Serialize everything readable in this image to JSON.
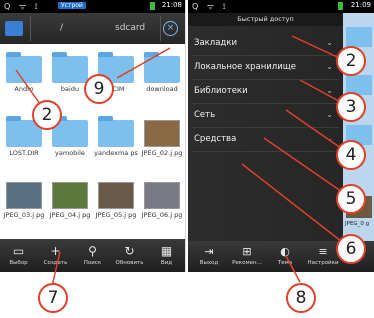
{
  "left_phone": {
    "status": {
      "icons_left": "Q ᯤ ⟟",
      "app_badge": "Устрой",
      "time": "21:08"
    },
    "pathbar": {
      "root": "/",
      "current": "sdcard"
    },
    "tiles": [
      {
        "kind": "folder",
        "label": "Andro"
      },
      {
        "kind": "folder",
        "label": "baidu"
      },
      {
        "kind": "folder",
        "label": "DCIM"
      },
      {
        "kind": "folder",
        "label": "download"
      },
      {
        "kind": "folder",
        "label": "LOST.DIR"
      },
      {
        "kind": "folder",
        "label": "yamobile"
      },
      {
        "kind": "folder",
        "label": "yandexma ps"
      },
      {
        "kind": "photo",
        "label": "JPEG_02.j pg",
        "color": "#8a6a44"
      },
      {
        "kind": "photo",
        "label": "JPEG_03.j pg",
        "color": "#596f84"
      },
      {
        "kind": "photo",
        "label": "JPEG_04.j pg",
        "color": "#5c7a3c"
      },
      {
        "kind": "photo",
        "label": "JPEG_05.j pg",
        "color": "#6a5a4a"
      },
      {
        "kind": "photo",
        "label": "JPEG_06.j pg",
        "color": "#7a7a86"
      }
    ],
    "toolbar": [
      {
        "icon": "select-icon",
        "glyph": "▭",
        "label": "Выбор"
      },
      {
        "icon": "plus-icon",
        "glyph": "+",
        "label": "Создать"
      },
      {
        "icon": "search-icon",
        "glyph": "⚲",
        "label": "Поиск"
      },
      {
        "icon": "refresh-icon",
        "glyph": "↻",
        "label": "Обновить"
      },
      {
        "icon": "grid-icon",
        "glyph": "▦",
        "label": "Вид"
      }
    ]
  },
  "right_phone": {
    "status": {
      "icons_left": "Q ᯤ ⟟",
      "time": "21:09"
    },
    "title": "Быстрый доступ",
    "drawer": [
      {
        "label": "Закладки"
      },
      {
        "label": "Локальное хранилище"
      },
      {
        "label": "Библиотеки"
      },
      {
        "label": "Сеть"
      },
      {
        "label": "Средства"
      }
    ],
    "peek_label": "JPEG_0 g",
    "toolbar": [
      {
        "icon": "exit-icon",
        "glyph": "⇥",
        "label": "Выход"
      },
      {
        "icon": "gift-icon",
        "glyph": "⊞",
        "label": "Рекомен..."
      },
      {
        "icon": "theme-icon",
        "glyph": "◐",
        "label": "Тема"
      },
      {
        "icon": "settings-icon",
        "glyph": "≡",
        "label": "Настройки"
      }
    ]
  },
  "callouts": [
    "2",
    "9",
    "7",
    "2",
    "3",
    "4",
    "5",
    "6",
    "8"
  ],
  "colors": {
    "callout": "#e0402a",
    "folder": "#7dc0ee",
    "accent": "#1a6fd1"
  }
}
